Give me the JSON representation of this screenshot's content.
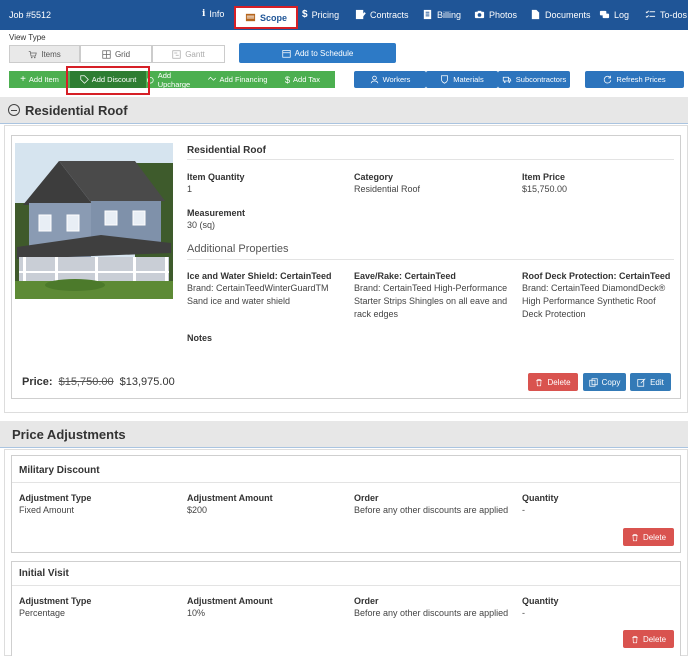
{
  "topbar": {
    "job": "Job #5512",
    "tabs": [
      "Info",
      "Scope",
      "Pricing",
      "Contracts",
      "Billing",
      "Photos",
      "Documents",
      "Log",
      "To-dos"
    ]
  },
  "view_type": {
    "label": "View Type",
    "options": [
      "Items",
      "Grid",
      "Gantt"
    ],
    "schedule": "Add to Schedule"
  },
  "toolbar": {
    "green": [
      "Add Item",
      "Add Discount",
      "Add Upcharge",
      "Add Financing",
      "Add Tax"
    ],
    "blue": [
      "Workers",
      "Materials",
      "Subcontractors"
    ],
    "refresh": "Refresh Prices"
  },
  "item": {
    "section_title": "Residential Roof",
    "name": "Residential Roof",
    "quantity_label": "Item Quantity",
    "quantity": "1",
    "category_label": "Category",
    "category": "Residential Roof",
    "price_label": "Item Price",
    "price": "$15,750.00",
    "measurement_label": "Measurement",
    "measurement": "30 (sq)",
    "additional_label": "Additional Properties",
    "props": [
      {
        "name": "Ice and Water Shield: CertainTeed",
        "value": "Brand: CertainTeedWinterGuardTM Sand ice and water shield"
      },
      {
        "name": "Eave/Rake: CertainTeed",
        "value": "Brand: CertainTeed High-Performance Starter Strips Shingles on all eave and rack edges"
      },
      {
        "name": "Roof Deck Protection: CertainTeed",
        "value": "Brand: CertainTeed DiamondDeck® High Performance Synthetic Roof Deck Protection"
      }
    ],
    "notes_label": "Notes",
    "price_row": {
      "label": "Price:",
      "old": "$15,750.00",
      "new": "$13,975.00"
    },
    "actions": [
      "Delete",
      "Copy",
      "Edit"
    ]
  },
  "adjustments": {
    "title": "Price Adjustments",
    "headers": [
      "Adjustment Type",
      "Adjustment Amount",
      "Order",
      "Quantity"
    ],
    "delete": "Delete",
    "list": [
      {
        "name": "Military Discount",
        "type": "Fixed Amount",
        "amount": "$200",
        "order": "Before any other discounts are applied",
        "quantity": "-"
      },
      {
        "name": "Initial Visit",
        "type": "Percentage",
        "amount": "10%",
        "order": "Before any other discounts are applied",
        "quantity": "-"
      }
    ]
  },
  "colors": {
    "nav": "#1f5597",
    "green": "#4caf50",
    "blue": "#2c74bd",
    "red": "#d9534f",
    "highlight": "#d61f26"
  }
}
